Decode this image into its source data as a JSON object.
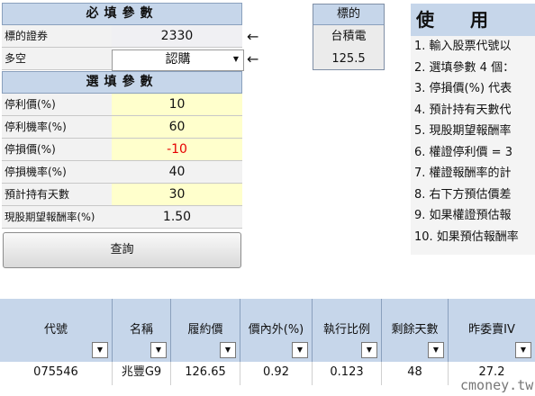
{
  "required": {
    "header": "必填參數",
    "rows": [
      {
        "label": "標的證券",
        "value": "2330"
      },
      {
        "label": "多空",
        "value": "認購"
      }
    ],
    "arrow": "←"
  },
  "optional": {
    "header": "選填參數",
    "rows": [
      {
        "label": "停利價(%)",
        "value": "10"
      },
      {
        "label": "停利機率(%)",
        "value": "60"
      },
      {
        "label": "停損價(%)",
        "value": "-10"
      },
      {
        "label": "停損機率(%)",
        "value": "40"
      },
      {
        "label": "預計持有天數",
        "value": "30"
      },
      {
        "label": "現股期望報酬率(%)",
        "value": "1.50"
      }
    ]
  },
  "stock": {
    "title": "標的",
    "name": "台積電",
    "price": "125.5"
  },
  "instructions": {
    "title": "使　　用",
    "items": [
      "1. 輸入股票代號以",
      "2. 選填參數 4 個：",
      "3. 停損價(%) 代表",
      "4. 預計持有天數代",
      "5. 現股期望報酬率",
      "6. 權證停利價 = 3",
      "7. 權證報酬率的計",
      "8. 右下方預估價差",
      "9. 如果權證預估報",
      "10. 如果預估報酬率"
    ]
  },
  "query_button": "查詢",
  "table": {
    "columns": [
      "代號",
      "名稱",
      "履約價",
      "價內外(%)",
      "執行比例",
      "剩餘天數",
      "昨委賣IV"
    ],
    "rows": [
      [
        "075546",
        "兆豐G9",
        "126.65",
        "0.92",
        "0.123",
        "48",
        "27.2"
      ]
    ]
  },
  "icons": {
    "dropdown": "chevron-down-icon",
    "filter": "filter-icon"
  },
  "watermark": "cmoney.tw"
}
